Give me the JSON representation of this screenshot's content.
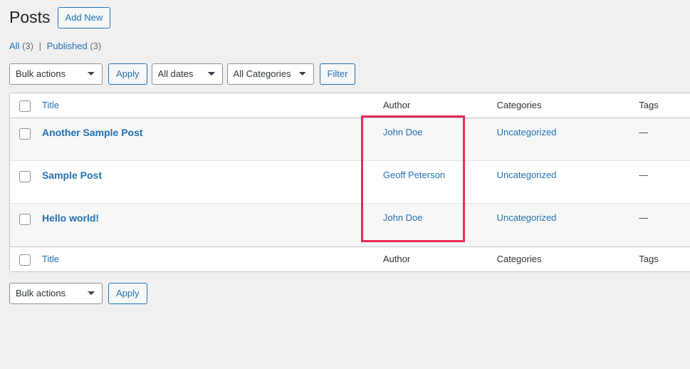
{
  "header": {
    "title": "Posts",
    "add_new_label": "Add New"
  },
  "status_links": [
    {
      "label": "All",
      "count": "(3)"
    },
    {
      "label": "Published",
      "count": "(3)"
    }
  ],
  "separator": "|",
  "toolbar_top": {
    "bulk_actions_value": "Bulk actions",
    "apply_label": "Apply",
    "dates_value": "All dates",
    "categories_value": "All Categories",
    "filter_label": "Filter"
  },
  "toolbar_bottom": {
    "bulk_actions_value": "Bulk actions",
    "apply_label": "Apply"
  },
  "table": {
    "columns": {
      "title": "Title",
      "author": "Author",
      "categories": "Categories",
      "tags": "Tags"
    },
    "rows": [
      {
        "title": "Another Sample Post",
        "author": "John Doe",
        "categories": "Uncategorized",
        "tags": "—"
      },
      {
        "title": "Sample Post",
        "author": "Geoff Peterson",
        "categories": "Uncategorized",
        "tags": "—"
      },
      {
        "title": "Hello world!",
        "author": "John Doe",
        "categories": "Uncategorized",
        "tags": "—"
      }
    ]
  },
  "annotation": {
    "color": "#e82a55",
    "target": "author-column"
  },
  "colors": {
    "page_background": "#f0f0f1",
    "link": "#2271b1",
    "text": "#3c434a",
    "row_alternate": "#f6f7f7",
    "border": "#c3c4c7"
  }
}
